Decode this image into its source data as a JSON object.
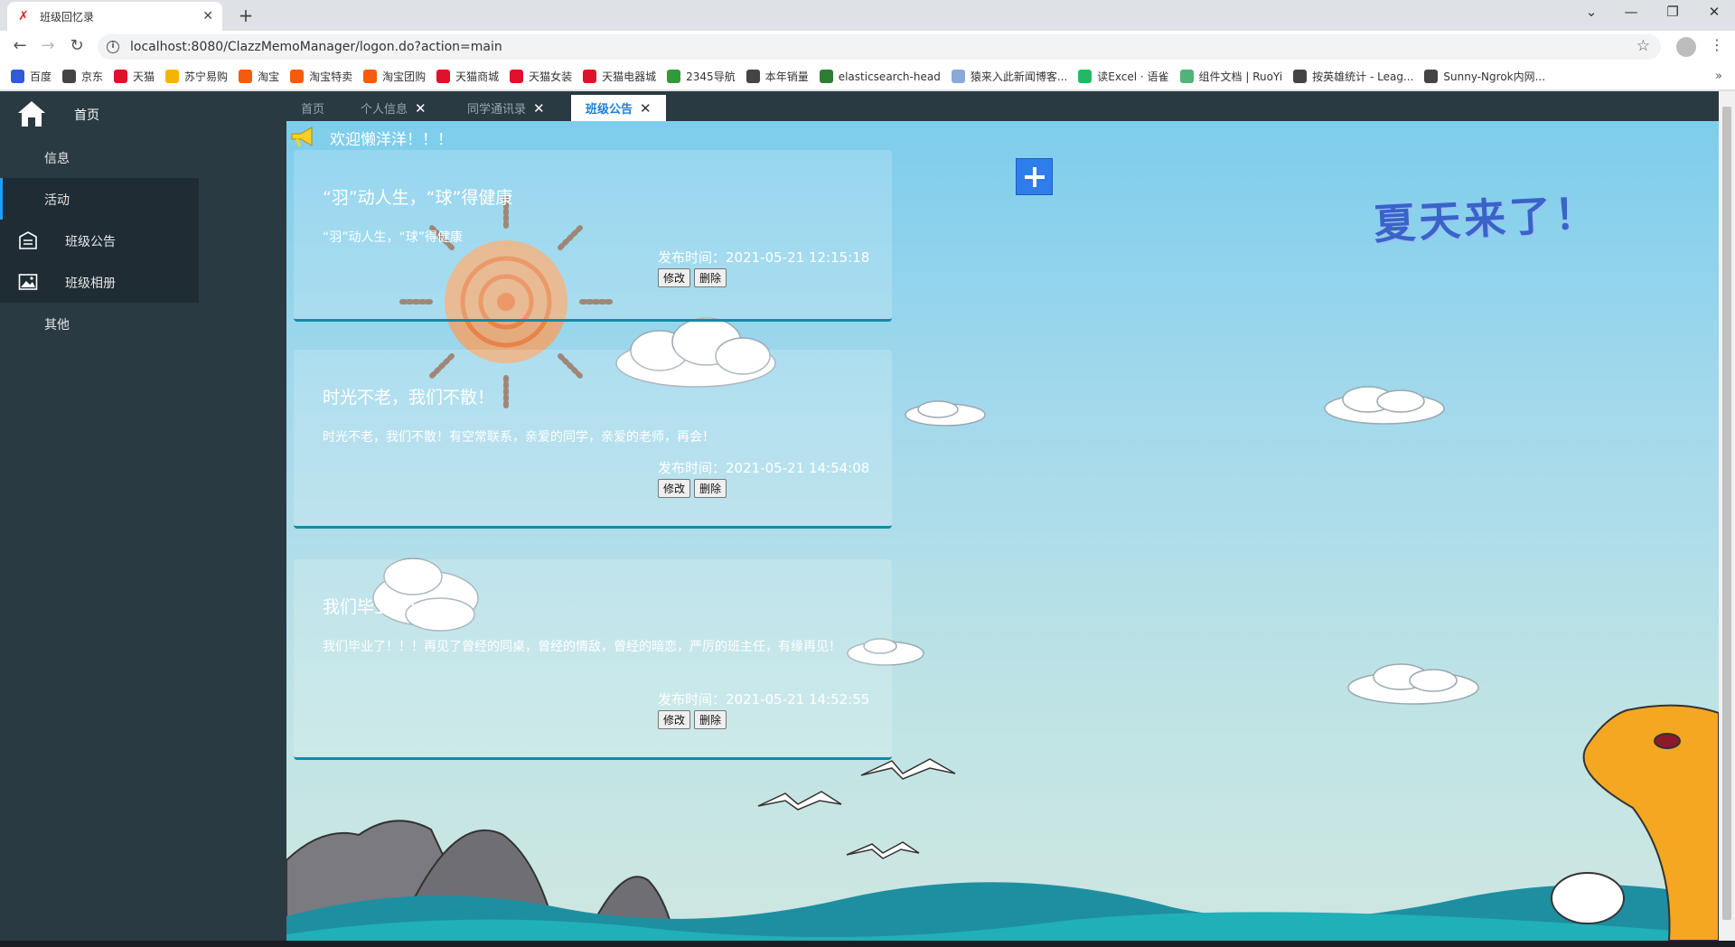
{
  "browser": {
    "tab_title": "班级回忆录",
    "url": "localhost:8080/ClazzMemoManager/logon.do?action=main",
    "bookmarks": [
      {
        "label": "百度",
        "color": "#2f5bd6"
      },
      {
        "label": "京东",
        "color": "#444444"
      },
      {
        "label": "天猫",
        "color": "#e0112b"
      },
      {
        "label": "苏宁易购",
        "color": "#f5b400"
      },
      {
        "label": "淘宝",
        "color": "#f45b0c"
      },
      {
        "label": "淘宝特卖",
        "color": "#f45b0c"
      },
      {
        "label": "淘宝团购",
        "color": "#f45b0c"
      },
      {
        "label": "天猫商城",
        "color": "#e0112b"
      },
      {
        "label": "天猫女装",
        "color": "#e0112b"
      },
      {
        "label": "天猫电器城",
        "color": "#e0112b"
      },
      {
        "label": "2345导航",
        "color": "#2e9b3a"
      },
      {
        "label": "本年销量",
        "color": "#444444"
      },
      {
        "label": "elasticsearch-head",
        "color": "#2e7d32"
      },
      {
        "label": "猿来入此新闻博客...",
        "color": "#8aa8d8"
      },
      {
        "label": "读Excel · 语雀",
        "color": "#25b864"
      },
      {
        "label": "组件文档 | RuoYi",
        "color": "#4fb37a"
      },
      {
        "label": "按英雄统计 - Leag...",
        "color": "#444444"
      },
      {
        "label": "Sunny-Ngrok内网...",
        "color": "#444444"
      }
    ],
    "bookmarks_more": "»"
  },
  "sidebar": {
    "home": "首页",
    "items": [
      {
        "label": "信息"
      },
      {
        "label": "活动"
      },
      {
        "label": "班级公告"
      },
      {
        "label": "班级相册"
      },
      {
        "label": "其他"
      }
    ]
  },
  "tabs": [
    {
      "label": "首页"
    },
    {
      "label": "个人信息"
    },
    {
      "label": "同学通讯录"
    },
    {
      "label": "班级公告"
    }
  ],
  "welcome": "欢迎懒洋洋！！！",
  "notices": [
    {
      "title": "“羽”动人生，“球”得健康",
      "body": "“羽”动人生，“球”得健康",
      "time": "发布时间：2021-05-21 12:15:18",
      "edit": "修改",
      "delete": "删除"
    },
    {
      "title": "时光不老，我们不散！",
      "body": "时光不老，我们不散！有空常联系，亲爱的同学，亲爱的老师，再会！",
      "time": "发布时间：2021-05-21 14:54:08",
      "edit": "修改",
      "delete": "删除"
    },
    {
      "title": "我们毕业了！！！",
      "body": "我们毕业了！！！再见了曾经的同桌，曾经的情敌，曾经的暗恋，严厉的班主任，有缘再见！",
      "time": "发布时间：2021-05-21 14:52:55",
      "edit": "修改",
      "delete": "删除"
    }
  ],
  "banner": "夏天来了！",
  "colors": {
    "sidebar": "#2a3a42",
    "active_tab": "#1e7fd6",
    "add_button": "#2f7dea"
  }
}
